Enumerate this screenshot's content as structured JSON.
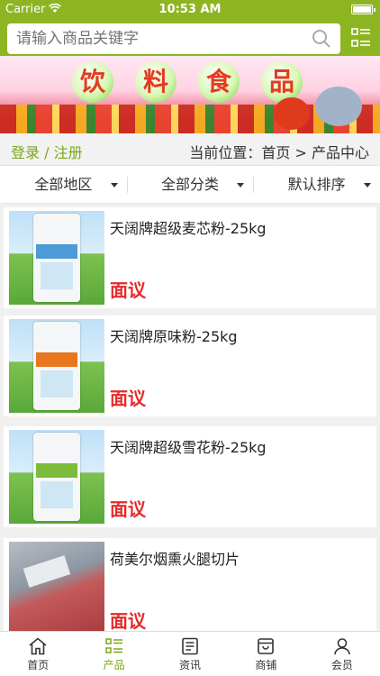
{
  "status": {
    "carrier": "Carrier",
    "time": "10:53 AM"
  },
  "search": {
    "placeholder": "请输入商品关键字"
  },
  "banner": {
    "chars": [
      "饮",
      "料",
      "食",
      "品"
    ]
  },
  "crumb": {
    "login": "登录 / 注册",
    "position": "当前位置：首页 > 产品中心"
  },
  "filters": [
    "全部地区",
    "全部分类",
    "默认排序"
  ],
  "products": [
    {
      "name": "天阔牌超级麦芯粉-25kg",
      "price": "面议",
      "band_color": "#4c9ad6"
    },
    {
      "name": "天阔牌原味粉-25kg",
      "price": "面议",
      "band_color": "#e8771f"
    },
    {
      "name": "天阔牌超级雪花粉-25kg",
      "price": "面议",
      "band_color": "#7dbb3b"
    },
    {
      "name": "荷美尔烟熏火腿切片",
      "price": "面议",
      "band_color": "#c0404a"
    }
  ],
  "tabs": [
    {
      "label": "首页",
      "icon": "home-icon"
    },
    {
      "label": "产品",
      "icon": "grid-list-icon",
      "active": true
    },
    {
      "label": "资讯",
      "icon": "news-icon"
    },
    {
      "label": "商铺",
      "icon": "shop-icon"
    },
    {
      "label": "会员",
      "icon": "user-icon"
    }
  ],
  "colors": {
    "accent": "#8db521",
    "price": "#e52b2b",
    "active_tab": "#7aa81a"
  }
}
